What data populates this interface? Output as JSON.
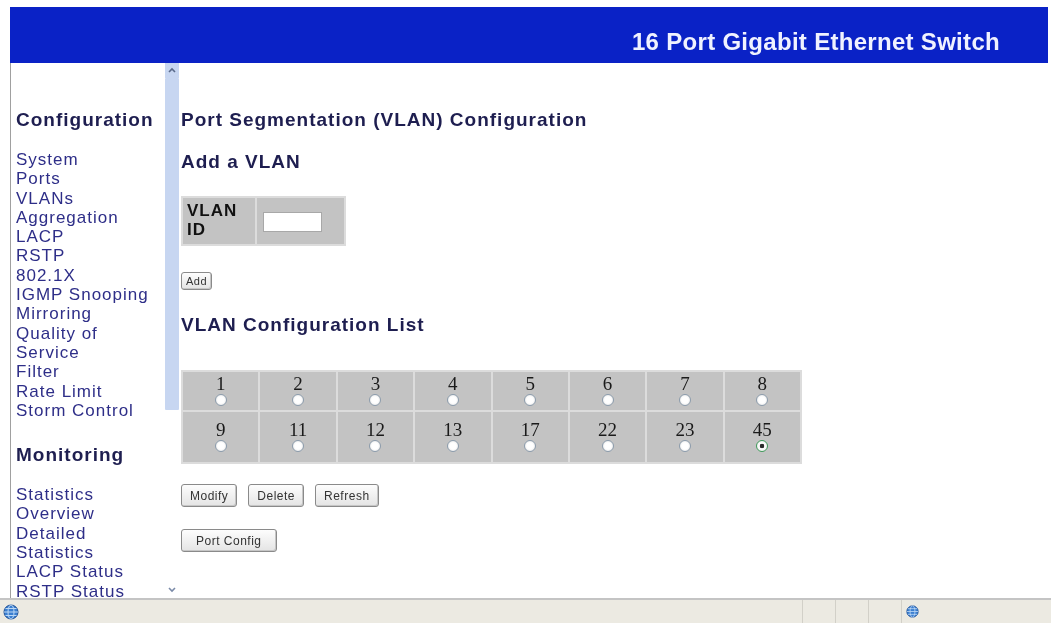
{
  "header": {
    "title": "16 Port Gigabit Ethernet Switch"
  },
  "sidebar": {
    "sections": [
      {
        "heading": "Configuration",
        "items": [
          "System",
          "Ports",
          "VLANs",
          "Aggregation",
          "LACP",
          "RSTP",
          "802.1X",
          "IGMP Snooping",
          "Mirroring",
          "Quality of Service",
          "Filter",
          "Rate Limit",
          "Storm Control"
        ]
      },
      {
        "heading": "Monitoring",
        "items": [
          "Statistics Overview",
          "Detailed Statistics",
          "LACP Status",
          "RSTP Status"
        ]
      }
    ]
  },
  "main": {
    "title": "Port Segmentation (VLAN) Configuration",
    "add_vlan": {
      "heading": "Add a VLAN",
      "field_label": "VLAN ID",
      "button": "Add"
    },
    "vlan_list": {
      "heading": "VLAN Configuration List",
      "vlans": [
        {
          "label": "1",
          "selected": false
        },
        {
          "label": "2",
          "selected": false
        },
        {
          "label": "3",
          "selected": false
        },
        {
          "label": "4",
          "selected": false
        },
        {
          "label": "5",
          "selected": false
        },
        {
          "label": "6",
          "selected": false
        },
        {
          "label": "7",
          "selected": false
        },
        {
          "label": "8",
          "selected": false
        },
        {
          "label": "9",
          "selected": false
        },
        {
          "label": "11",
          "selected": false
        },
        {
          "label": "12",
          "selected": false
        },
        {
          "label": "13",
          "selected": false
        },
        {
          "label": "17",
          "selected": false
        },
        {
          "label": "22",
          "selected": false
        },
        {
          "label": "23",
          "selected": false
        },
        {
          "label": "45",
          "selected": true
        }
      ],
      "buttons": [
        "Modify",
        "Delete",
        "Refresh"
      ],
      "port_config_button": "Port Config"
    }
  }
}
